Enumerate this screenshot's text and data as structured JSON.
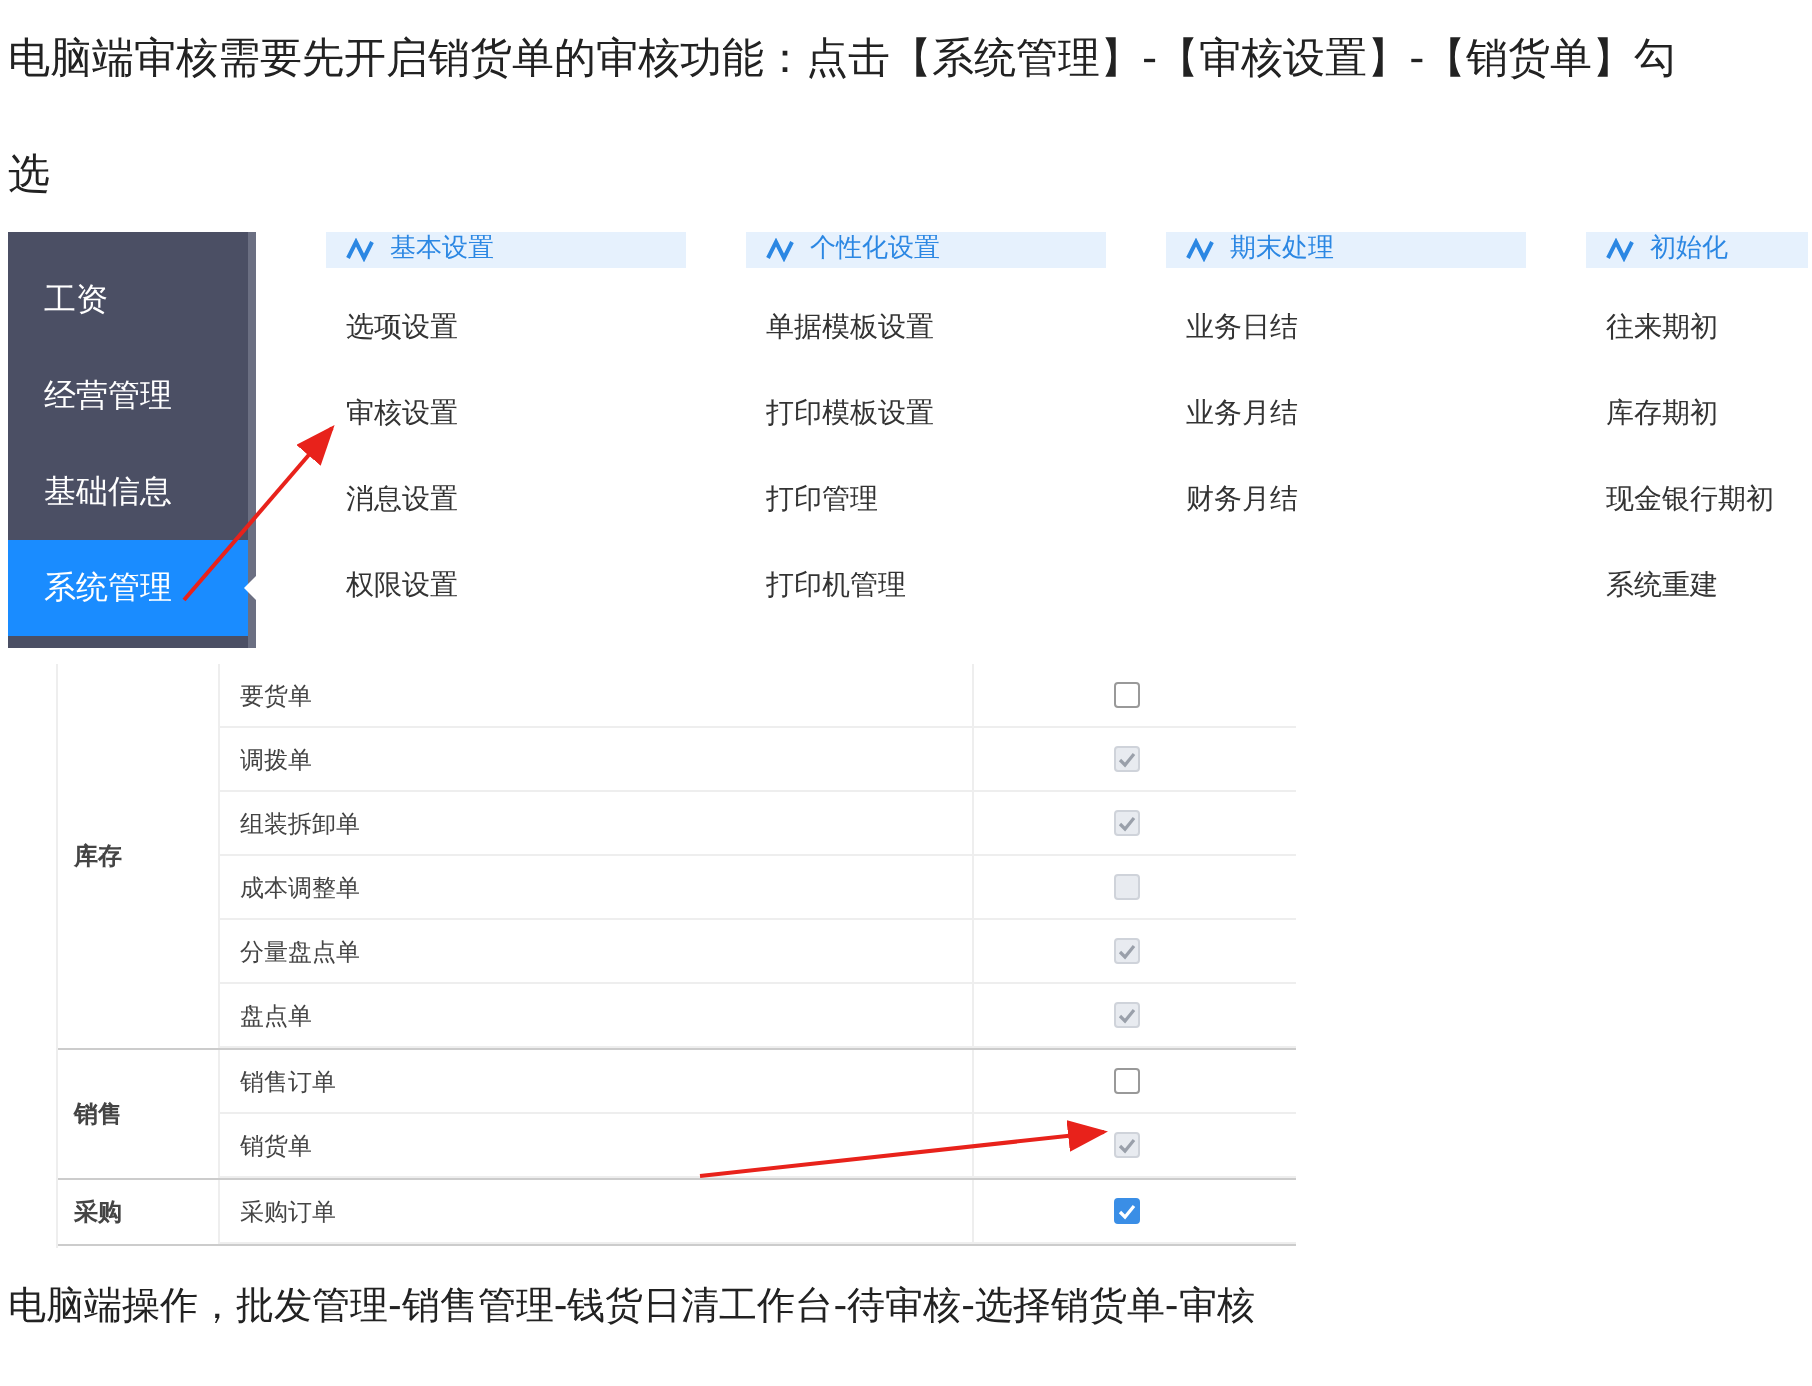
{
  "intro": "电脑端审核需要先开启销货单的审核功能：点击【系统管理】-【审核设置】-【销货单】勾选",
  "screenshot_1": {
    "sidebar": [
      {
        "label": "工资",
        "selected": false
      },
      {
        "label": "经营管理",
        "selected": false
      },
      {
        "label": "基础信息",
        "selected": false
      },
      {
        "label": "系统管理",
        "selected": true
      }
    ],
    "columns": [
      {
        "header": "基本设置",
        "items": [
          "选项设置",
          "审核设置",
          "消息设置",
          "权限设置"
        ]
      },
      {
        "header": "个性化设置",
        "items": [
          "单据模板设置",
          "打印模板设置",
          "打印管理",
          "打印机管理"
        ]
      },
      {
        "header": "期末处理",
        "items": [
          "业务日结",
          "业务月结",
          "财务月结"
        ]
      },
      {
        "header": "初始化",
        "items": [
          "往来期初",
          "库存期初",
          "现金银行期初",
          "系统重建"
        ]
      }
    ]
  },
  "screenshot_2": {
    "groups": [
      {
        "category": "库存",
        "rows": [
          {
            "label": "要货单",
            "checked": false,
            "disabled": false
          },
          {
            "label": "调拨单",
            "checked": true,
            "disabled": true
          },
          {
            "label": "组装拆卸单",
            "checked": true,
            "disabled": true
          },
          {
            "label": "成本调整单",
            "checked": false,
            "disabled": true
          },
          {
            "label": "分量盘点单",
            "checked": true,
            "disabled": true
          },
          {
            "label": "盘点单",
            "checked": true,
            "disabled": true
          }
        ]
      },
      {
        "category": "销售",
        "rows": [
          {
            "label": "销售订单",
            "checked": false,
            "disabled": false
          },
          {
            "label": "销货单",
            "checked": true,
            "disabled": true
          }
        ]
      },
      {
        "category": "采购",
        "rows": [
          {
            "label": "采购订单",
            "checked": true,
            "disabled": false
          }
        ]
      }
    ]
  },
  "outro": "电脑端操作，批发管理-销售管理-钱货日清工作台-待审核-选择销货单-审核"
}
